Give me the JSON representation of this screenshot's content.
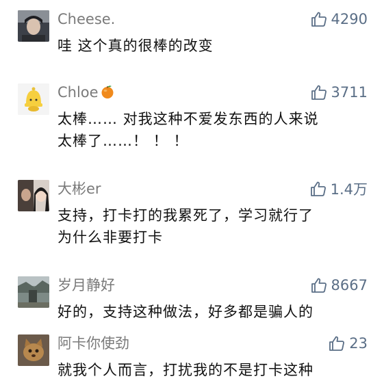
{
  "comments": [
    {
      "username": "Cheese.",
      "likes": "4290",
      "lines": [
        "哇 这个真的很棒的改变"
      ],
      "avatar_icon": "avatar-photo-icon"
    },
    {
      "username": "Chloe",
      "username_emoji": "orange-emoji-icon",
      "likes": "3711",
      "lines": [
        "太棒…… 对我这种不爱发东西的人来说",
        "太棒了……！ ！ ！"
      ],
      "avatar_icon": "avatar-cartoon-icon"
    },
    {
      "username": "大彬er",
      "likes": "1.4万",
      "lines": [
        "支持，打卡打的我累死了，学习就行了",
        "为什么非要打卡"
      ],
      "avatar_icon": "avatar-photo-icon"
    },
    {
      "username": "岁月静好",
      "likes": "8667",
      "lines": [
        "好的，支持这种做法，好多都是骗人的"
      ],
      "avatar_icon": "avatar-photo-icon"
    },
    {
      "username": "阿卡你使劲",
      "likes": "23",
      "lines": [
        "就我个人而言，打扰我的不是打卡这种"
      ],
      "avatar_icon": "avatar-photo-icon"
    }
  ],
  "colors": {
    "username": "#7a7a7a",
    "like": "#5a6e86",
    "text": "#111111",
    "background": "#ffffff"
  }
}
